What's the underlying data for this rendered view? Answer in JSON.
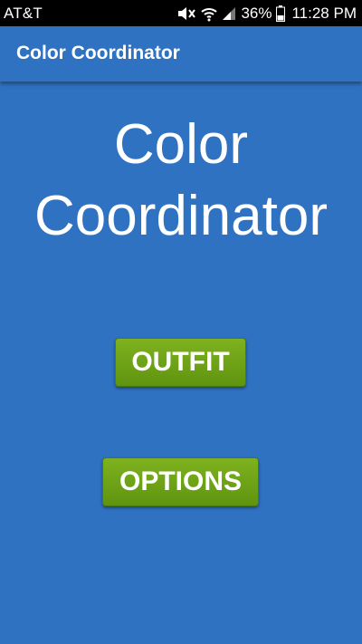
{
  "status_bar": {
    "carrier": "AT&T",
    "battery_percent": "36%",
    "time": "11:28 PM",
    "icons": [
      "mute-icon",
      "wifi-icon",
      "signal-icon",
      "battery-icon"
    ]
  },
  "app_bar": {
    "title": "Color Coordinator"
  },
  "main": {
    "headline_line1": "Color",
    "headline_line2": "Coordinator",
    "outfit_button": "OUTFIT",
    "options_button": "OPTIONS"
  },
  "colors": {
    "background": "#3072c2",
    "button_green": "#6fa317",
    "text": "#ffffff"
  }
}
